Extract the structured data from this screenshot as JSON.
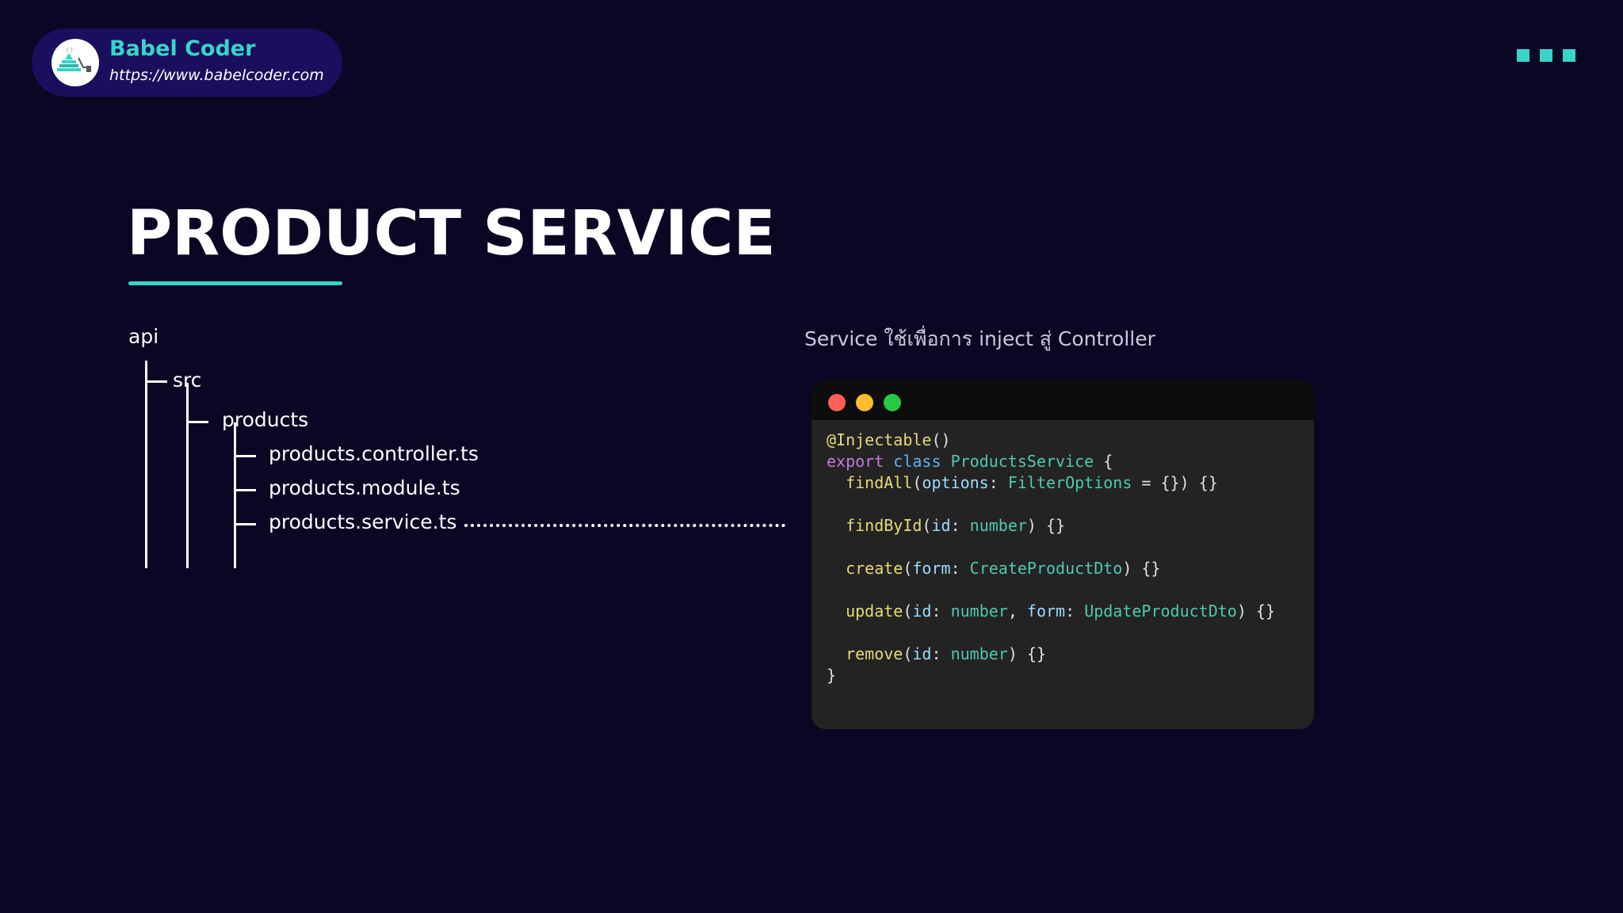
{
  "brand": {
    "name": "Babel Coder",
    "url": "https://www.babelcoder.com"
  },
  "slide": {
    "title": "PRODUCT SERVICE",
    "caption": "Service ใช้เพื่อการ inject สู่ Controller"
  },
  "file_tree": {
    "root": "api",
    "src": "src",
    "products": "products",
    "files": [
      "products.controller.ts",
      "products.module.ts",
      "products.service.ts"
    ]
  },
  "code": {
    "window_controls": {
      "close_color": "#ff5f57",
      "minimize_color": "#febc2e",
      "maximize_color": "#28c840"
    },
    "decorator": "@Injectable",
    "decorator_parens": "()",
    "export_kw": "export",
    "class_kw": "class",
    "class_name": "ProductsService",
    "open_brace": "{",
    "close_brace": "}",
    "methods": {
      "findAll": {
        "name": "findAll",
        "p1": "options",
        "t1": "FilterOptions",
        "default": " = {}",
        "tail": ") {}"
      },
      "findById": {
        "name": "findById",
        "p1": "id",
        "t1": "number",
        "tail": ") {}"
      },
      "create": {
        "name": "create",
        "p1": "form",
        "t1": "CreateProductDto",
        "tail": ") {}"
      },
      "update": {
        "name": "update",
        "p1": "id",
        "t1": "number",
        "p2": "form",
        "t2": "UpdateProductDto",
        "tail": ") {}"
      },
      "remove": {
        "name": "remove",
        "p1": "id",
        "t1": "number",
        "tail": ") {}"
      }
    }
  },
  "colors": {
    "background": "#0a0725",
    "accent": "#38d4c8",
    "brand_pill": "#1a0f5c",
    "code_bg": "#232323"
  },
  "icons": {
    "brand_logo": "babel-coder-logo",
    "decoration": "three-squares"
  }
}
